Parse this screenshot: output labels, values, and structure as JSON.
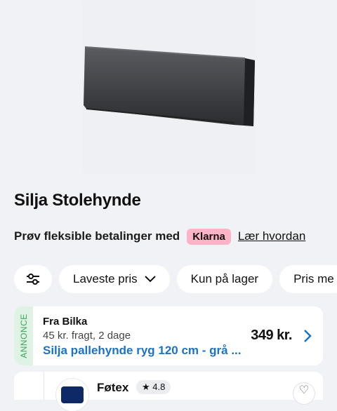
{
  "product": {
    "title": "Silja Stolehynde",
    "image_alt": "Grey cushion"
  },
  "klarna": {
    "text": "Prøv fleksible betalinger med",
    "badge": "Klarna",
    "link": "Lær hvordan",
    "badge_color": "#ffb3c7"
  },
  "filters": {
    "settings_icon": "sliders-icon",
    "sort_label": "Laveste pris",
    "stock_label": "Kun på lager",
    "more_label": "Pris me"
  },
  "ad": {
    "tag": "ANNONCE",
    "from": "Fra Bilka",
    "shipping": "45 kr. fragt, 2 dage",
    "product": "Silja pallehynde ryg 120 cm - grå ...",
    "price": "349 kr.",
    "link_color": "#1a73c9"
  },
  "store": {
    "name": "Føtex",
    "rating": "★ 4.8",
    "button": "♡"
  }
}
